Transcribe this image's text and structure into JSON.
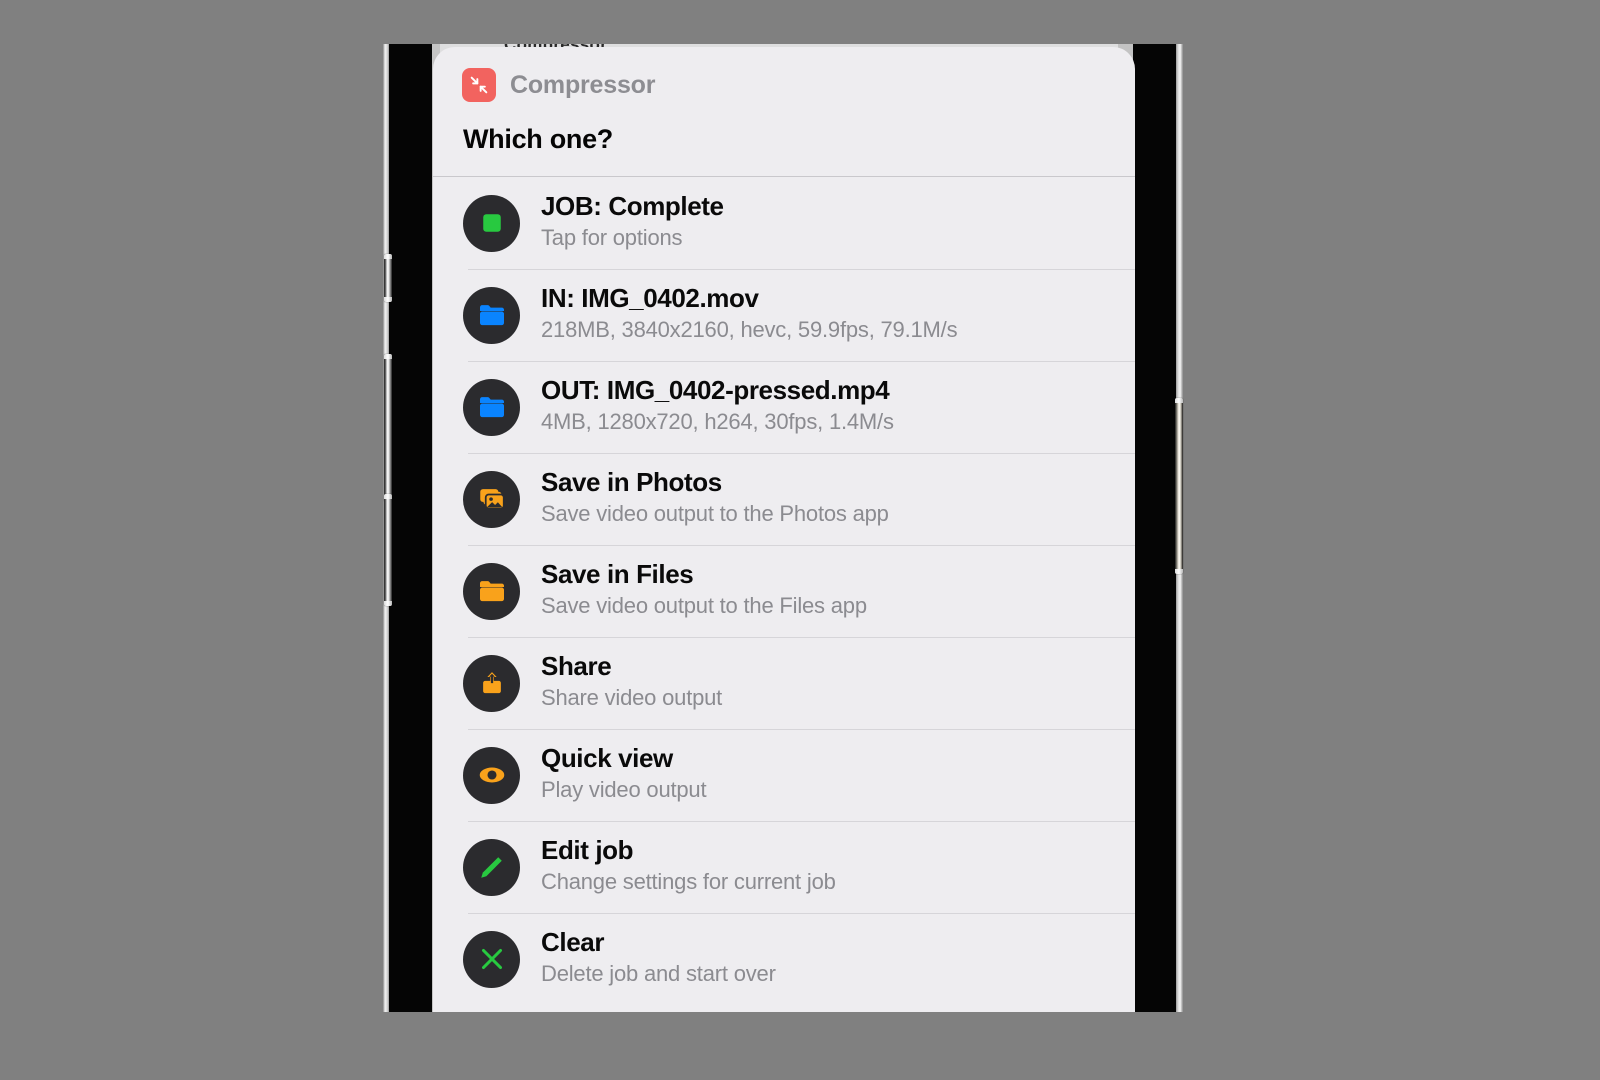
{
  "background": {
    "partial_text": "Compressor"
  },
  "colors": {
    "app_accent": "#f2635f",
    "sheet_bg": "#eeedf0",
    "icon_circle": "#2b2b2e",
    "green": "#28c940",
    "blue": "#0a84ff",
    "orange": "#f9a21b",
    "title_text": "#0a0a0a",
    "sub_text": "#8b8b90",
    "app_title_text": "#8d8d92"
  },
  "header": {
    "app_icon_name": "compress-arrows-icon",
    "app_name": "Compressor",
    "prompt": "Which one?"
  },
  "list": [
    {
      "icon": "stop-square-icon",
      "icon_color": "#28c940",
      "title": "JOB: Complete",
      "subtitle": "Tap for options"
    },
    {
      "icon": "folder-icon",
      "icon_color": "#0a84ff",
      "title": "IN: IMG_0402.mov",
      "subtitle": "218MB, 3840x2160, hevc, 59.9fps, 79.1M/s"
    },
    {
      "icon": "folder-icon",
      "icon_color": "#0a84ff",
      "title": "OUT: IMG_0402-pressed.mp4",
      "subtitle": "4MB, 1280x720, h264, 30fps, 1.4M/s"
    },
    {
      "icon": "photos-stack-icon",
      "icon_color": "#f9a21b",
      "title": "Save in Photos",
      "subtitle": "Save video output to the Photos app"
    },
    {
      "icon": "folder-icon",
      "icon_color": "#f9a21b",
      "title": "Save in Files",
      "subtitle": "Save video output to the Files app"
    },
    {
      "icon": "share-upload-icon",
      "icon_color": "#f9a21b",
      "title": "Share",
      "subtitle": "Share video output"
    },
    {
      "icon": "eye-icon",
      "icon_color": "#f9a21b",
      "title": "Quick view",
      "subtitle": "Play video output"
    },
    {
      "icon": "pencil-icon",
      "icon_color": "#28c940",
      "title": "Edit job",
      "subtitle": "Change settings for current job"
    },
    {
      "icon": "x-close-icon",
      "icon_color": "#28c940",
      "title": "Clear",
      "subtitle": "Delete job and start over"
    }
  ],
  "device": {
    "buttons": [
      {
        "name": "silent-switch"
      },
      {
        "name": "volume-up-button"
      },
      {
        "name": "volume-down-button"
      },
      {
        "name": "power-button"
      }
    ]
  }
}
